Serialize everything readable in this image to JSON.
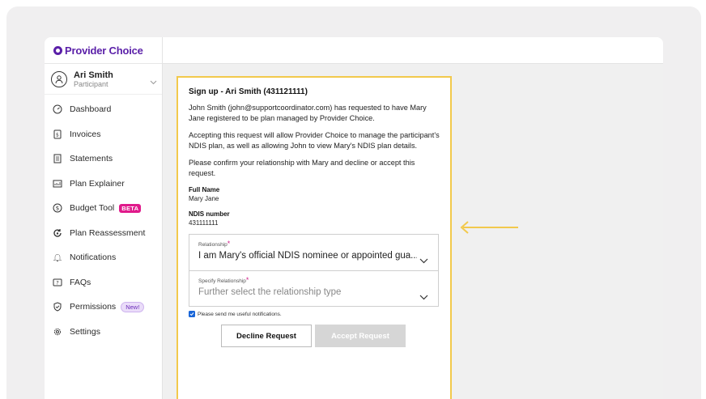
{
  "brand": {
    "name": "Provider Choice",
    "color": "#5a1fa8"
  },
  "user": {
    "name": "Ari Smith",
    "role": "Participant"
  },
  "nav": [
    {
      "label": "Dashboard",
      "icon": "dashboard-icon"
    },
    {
      "label": "Invoices",
      "icon": "invoice-icon"
    },
    {
      "label": "Statements",
      "icon": "statement-icon"
    },
    {
      "label": "Plan Explainer",
      "icon": "chart-icon"
    },
    {
      "label": "Budget Tool",
      "icon": "dollar-icon",
      "badge": "BETA"
    },
    {
      "label": "Plan Reassessment",
      "icon": "reassessment-icon"
    },
    {
      "label": "Notifications",
      "icon": "bell-icon"
    },
    {
      "label": "FAQs",
      "icon": "question-icon"
    },
    {
      "label": "Permissions",
      "icon": "shield-icon",
      "badge": "New!"
    },
    {
      "label": "Settings",
      "icon": "gear-icon"
    }
  ],
  "card": {
    "title": "Sign up - Ari Smith (431121111)",
    "para1": "John Smith (john@supportcoordinator.com) has requested to have Mary Jane registered to be plan managed by Provider Choice.",
    "para2": "Accepting this request will allow Provider Choice to manage the participant's NDIS plan, as well as allowing John to view Mary's NDIS plan details.",
    "para3": "Please confirm your relationship with Mary and decline or accept this request.",
    "full_name_label": "Full Name",
    "full_name_value": "Mary Jane",
    "ndis_label": "NDIS number",
    "ndis_value": "431111111",
    "relationship_label": "Relationship",
    "relationship_value": "I am Mary's official NDIS nominee or appointed gua...",
    "specify_label": "Specify Relationship",
    "specify_placeholder": "Further select the relationship type",
    "required_mark": "*",
    "checkbox_label": "Please send me useful notifications.",
    "checkbox_checked": true,
    "decline_label": "Decline Request",
    "accept_label": "Accept Request"
  },
  "colors": {
    "highlight_border": "#f2c94c",
    "arrow": "#f2c94c",
    "required": "#d0218a",
    "beta": "#e01a8b"
  }
}
